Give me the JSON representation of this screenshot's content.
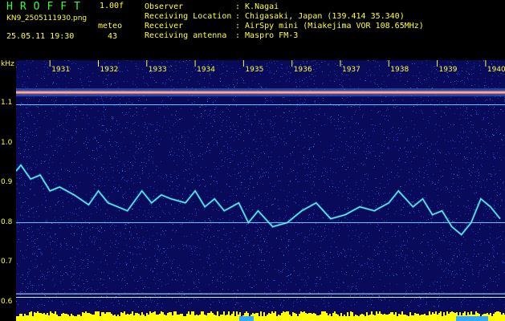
{
  "header": {
    "logo": "HROFFT",
    "version": "1.00f",
    "filename": "KN9_2505111930.png",
    "meteo_label": "meteo",
    "datetime": "25.05.11 19:30",
    "count": "43",
    "fields": [
      {
        "key": "Observer",
        "value": ": K.Nagai"
      },
      {
        "key": "Receiving Location",
        "value": ": Chigasaki, Japan (139.414 35.340)"
      },
      {
        "key": "Receiver",
        "value": ": AirSpy mini (Miakejima VOR 108.65MHz)"
      },
      {
        "key": "Receiving antenna",
        "value": ": Maspro FM-3"
      }
    ]
  },
  "chart_data": {
    "type": "spectrogram",
    "ylabel": "kHz",
    "yticks": [
      "1.1",
      "1.0",
      "0.9",
      "0.8",
      "0.7",
      "0.6"
    ],
    "xticks": [
      "1931",
      "1932",
      "1933",
      "1934",
      "1935",
      "1936",
      "1937",
      "1938",
      "1939",
      "1940"
    ],
    "ylim": [
      0.58,
      1.15
    ],
    "x_range": [
      1930.3,
      1940.4
    ],
    "carrier_khz": 1.128,
    "reference_lines_khz": [
      1.097,
      0.8,
      0.621,
      0.612
    ],
    "trace": {
      "x": [
        1930.3,
        1930.4,
        1930.6,
        1930.8,
        1931.0,
        1931.2,
        1931.5,
        1931.8,
        1932.0,
        1932.2,
        1932.4,
        1932.6,
        1932.9,
        1933.1,
        1933.3,
        1933.5,
        1933.8,
        1934.0,
        1934.2,
        1934.4,
        1934.6,
        1934.9,
        1935.1,
        1935.3,
        1935.6,
        1935.9,
        1936.2,
        1936.5,
        1936.8,
        1937.1,
        1937.4,
        1937.7,
        1938.0,
        1938.2,
        1938.5,
        1938.7,
        1938.9,
        1939.1,
        1939.3,
        1939.5,
        1939.7,
        1939.9,
        1940.1,
        1940.3
      ],
      "khz": [
        0.93,
        0.945,
        0.91,
        0.92,
        0.88,
        0.89,
        0.87,
        0.845,
        0.88,
        0.85,
        0.84,
        0.83,
        0.88,
        0.85,
        0.87,
        0.86,
        0.85,
        0.88,
        0.84,
        0.86,
        0.83,
        0.85,
        0.8,
        0.83,
        0.79,
        0.8,
        0.83,
        0.85,
        0.81,
        0.82,
        0.84,
        0.83,
        0.85,
        0.88,
        0.84,
        0.86,
        0.82,
        0.83,
        0.79,
        0.77,
        0.8,
        0.86,
        0.84,
        0.81
      ]
    },
    "colors": {
      "background": "#0a0a5a",
      "noise": "#1e3cc8",
      "trace": "#66ffcc",
      "reference": "#55c8ff",
      "carrier": "#ff7755",
      "labels": "#ffff33",
      "bottom_band": "#ffff00"
    }
  }
}
